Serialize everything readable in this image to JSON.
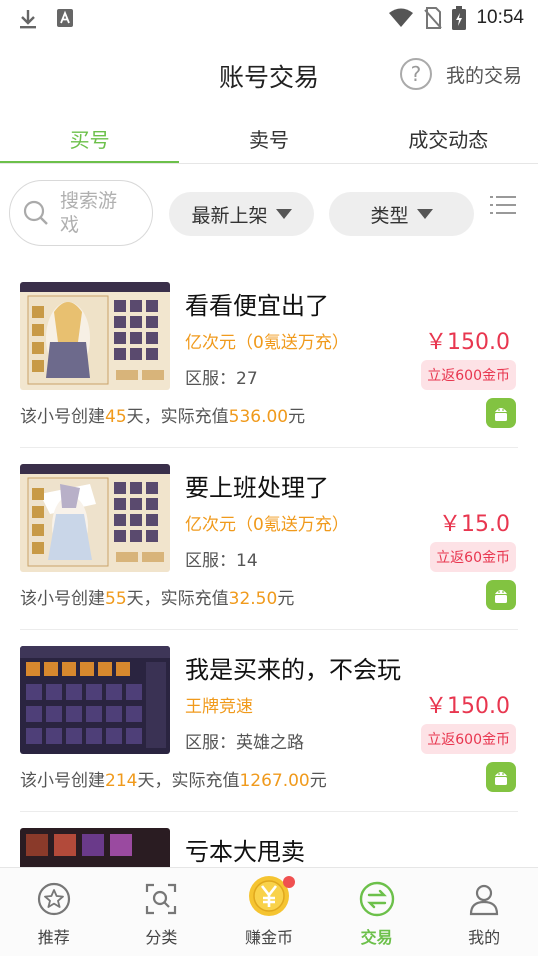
{
  "status_bar": {
    "time": "10:54",
    "icons": [
      "download-icon",
      "text-input-icon",
      "wifi-icon",
      "no-sim-icon",
      "battery-charging-icon"
    ]
  },
  "header": {
    "title": "账号交易",
    "my_trade_label": "我的交易",
    "help_icon": "help-circle-icon"
  },
  "tabs": [
    {
      "label": "买号",
      "active": true
    },
    {
      "label": "卖号",
      "active": false
    },
    {
      "label": "成交动态",
      "active": false
    }
  ],
  "filter": {
    "search_placeholder": "搜索游戏",
    "sort_label": "最新上架",
    "type_label": "类型",
    "list_icon": "list-view-icon"
  },
  "listings": [
    {
      "title": "看看便宜出了",
      "game": "亿次元（0氪送万充）",
      "server": "区服：27",
      "price": "￥150.0",
      "rebate": "立返600金币",
      "info_prefix": "该小号创建",
      "days": "45",
      "info_mid": "天，实际充值",
      "recharge": "536.00",
      "info_suffix": "元",
      "platform_icon": "android-icon"
    },
    {
      "title": "要上班处理了",
      "game": "亿次元（0氪送万充）",
      "server": "区服：14",
      "price": "￥15.0",
      "rebate": "立返60金币",
      "info_prefix": "该小号创建",
      "days": "55",
      "info_mid": "天，实际充值",
      "recharge": "32.50",
      "info_suffix": "元",
      "platform_icon": "android-icon"
    },
    {
      "title": "我是买来的，不会玩",
      "game": "王牌竞速",
      "server": "区服：英雄之路",
      "price": "￥150.0",
      "rebate": "立返600金币",
      "info_prefix": "该小号创建",
      "days": "214",
      "info_mid": "天，实际充值",
      "recharge": "1267.00",
      "info_suffix": "元",
      "platform_icon": "android-icon"
    },
    {
      "title": "亏本大甩卖"
    }
  ],
  "bottom_nav": [
    {
      "label": "推荐",
      "icon": "star-badge-icon",
      "active": false
    },
    {
      "label": "分类",
      "icon": "category-scan-icon",
      "active": false
    },
    {
      "label": "赚金币",
      "icon": "yen-coin-icon",
      "active": false,
      "has_dot": true
    },
    {
      "label": "交易",
      "icon": "exchange-icon",
      "active": true
    },
    {
      "label": "我的",
      "icon": "user-icon",
      "active": false
    }
  ],
  "colors": {
    "accent_green": "#6cc04a",
    "price_red": "#e8364f",
    "highlight_orange": "#f09a1c",
    "android_green": "#82c341"
  }
}
